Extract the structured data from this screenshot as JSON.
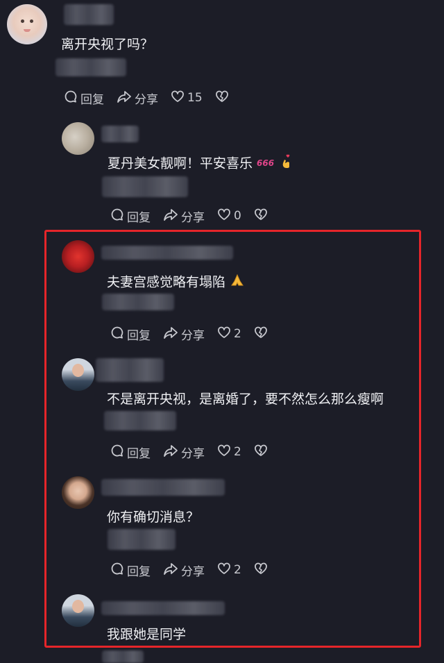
{
  "comments": [
    {
      "text": "离开央视了吗？",
      "reply_label": "回复",
      "share_label": "分享",
      "likes": "15"
    },
    {
      "text": "夏丹美女靓啊！平安喜乐",
      "reply_label": "回复",
      "share_label": "分享",
      "likes": "0"
    },
    {
      "text": "夫妻宫感觉略有塌陷",
      "reply_label": "回复",
      "share_label": "分享",
      "likes": "2"
    },
    {
      "text": "不是离开央视，是离婚了，要不然怎么那么瘦啊",
      "reply_label": "回复",
      "share_label": "分享",
      "likes": "2"
    },
    {
      "text": "你有确切消息？",
      "reply_label": "回复",
      "share_label": "分享",
      "likes": "2"
    },
    {
      "text": "我跟她是同学"
    }
  ],
  "colors": {
    "background": "#1c1d27",
    "highlight_border": "#e5252a",
    "text": "#f0f1f4",
    "muted": "#c8c9cf"
  },
  "icons": [
    "comment-icon",
    "share-icon",
    "heart-icon",
    "broken-heart-icon",
    "emoji-666-icon",
    "emoji-fingers-heart-icon",
    "emoji-pray-icon"
  ]
}
